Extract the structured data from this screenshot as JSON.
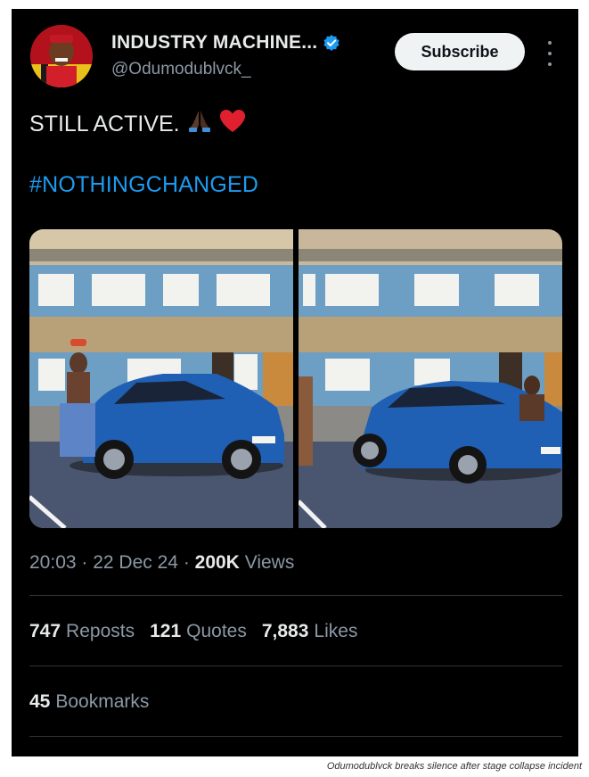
{
  "author": {
    "display_name": "INDUSTRY MACHINE...",
    "handle": "@Odumodublvck_",
    "avatar_icon": "profile-avatar",
    "verified_icon": "verified-badge-icon",
    "verified_color": "#1d9bf0"
  },
  "actions": {
    "subscribe_label": "Subscribe",
    "more_icon": "more-vertical-icon"
  },
  "post": {
    "text": "STILL ACTIVE.",
    "emojis": [
      "folded-hands-dark-skin",
      "red-heart"
    ],
    "hashtag": "#NOTHINGCHANGED",
    "hashtag_color": "#1d9bf0",
    "media_count": 2
  },
  "meta": {
    "time": "20:03",
    "date": "22 Dec 24",
    "views_count": "200K",
    "views_label": "Views"
  },
  "stats": [
    {
      "count": "747",
      "label": "Reposts"
    },
    {
      "count": "121",
      "label": "Quotes"
    },
    {
      "count": "7,883",
      "label": "Likes"
    }
  ],
  "bookmarks": {
    "count": "45",
    "label": "Bookmarks"
  },
  "caption": "Odumodublvck breaks silence after stage collapse incident"
}
